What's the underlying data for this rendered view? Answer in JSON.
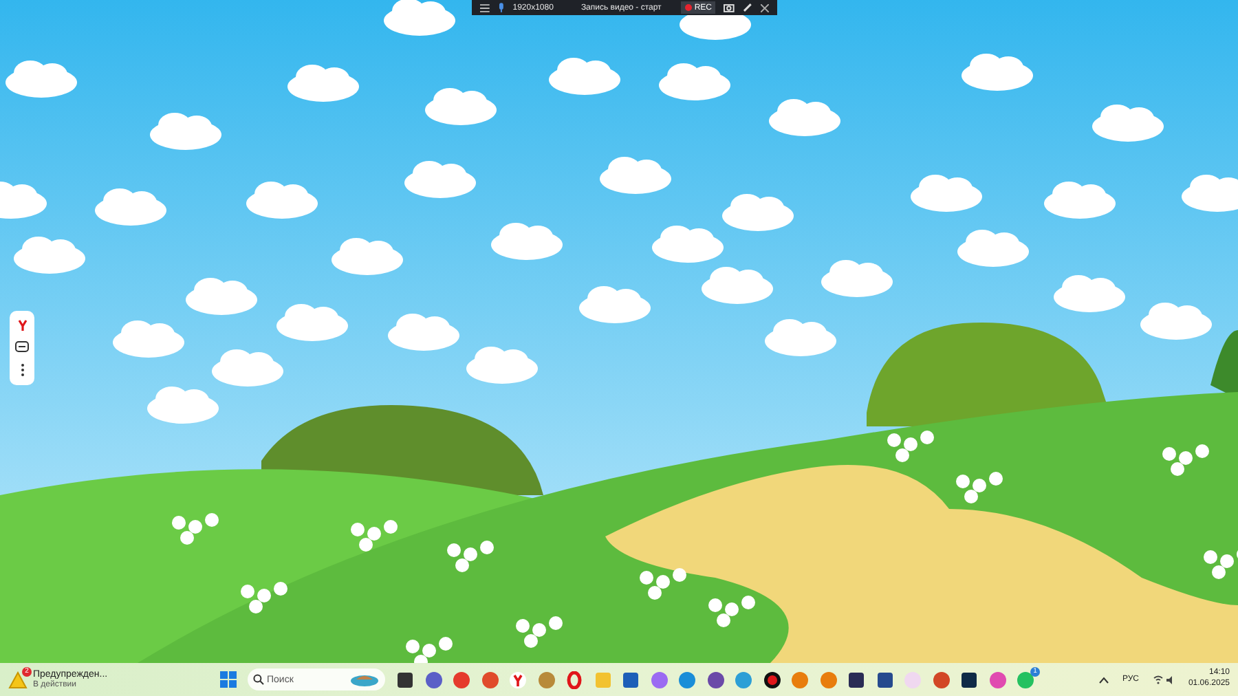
{
  "recorder_bar": {
    "resolution": "1920x1080",
    "title": "Запись видео - старт",
    "rec_label": "REC"
  },
  "taskbar": {
    "notification": {
      "title": "Предупрежден...",
      "subtitle": "В действии",
      "badge": "2"
    },
    "search": {
      "placeholder": "Поиск"
    },
    "messenger_badge": "1",
    "language": "РУС",
    "time": "14:10",
    "date": "01.06.2025"
  }
}
